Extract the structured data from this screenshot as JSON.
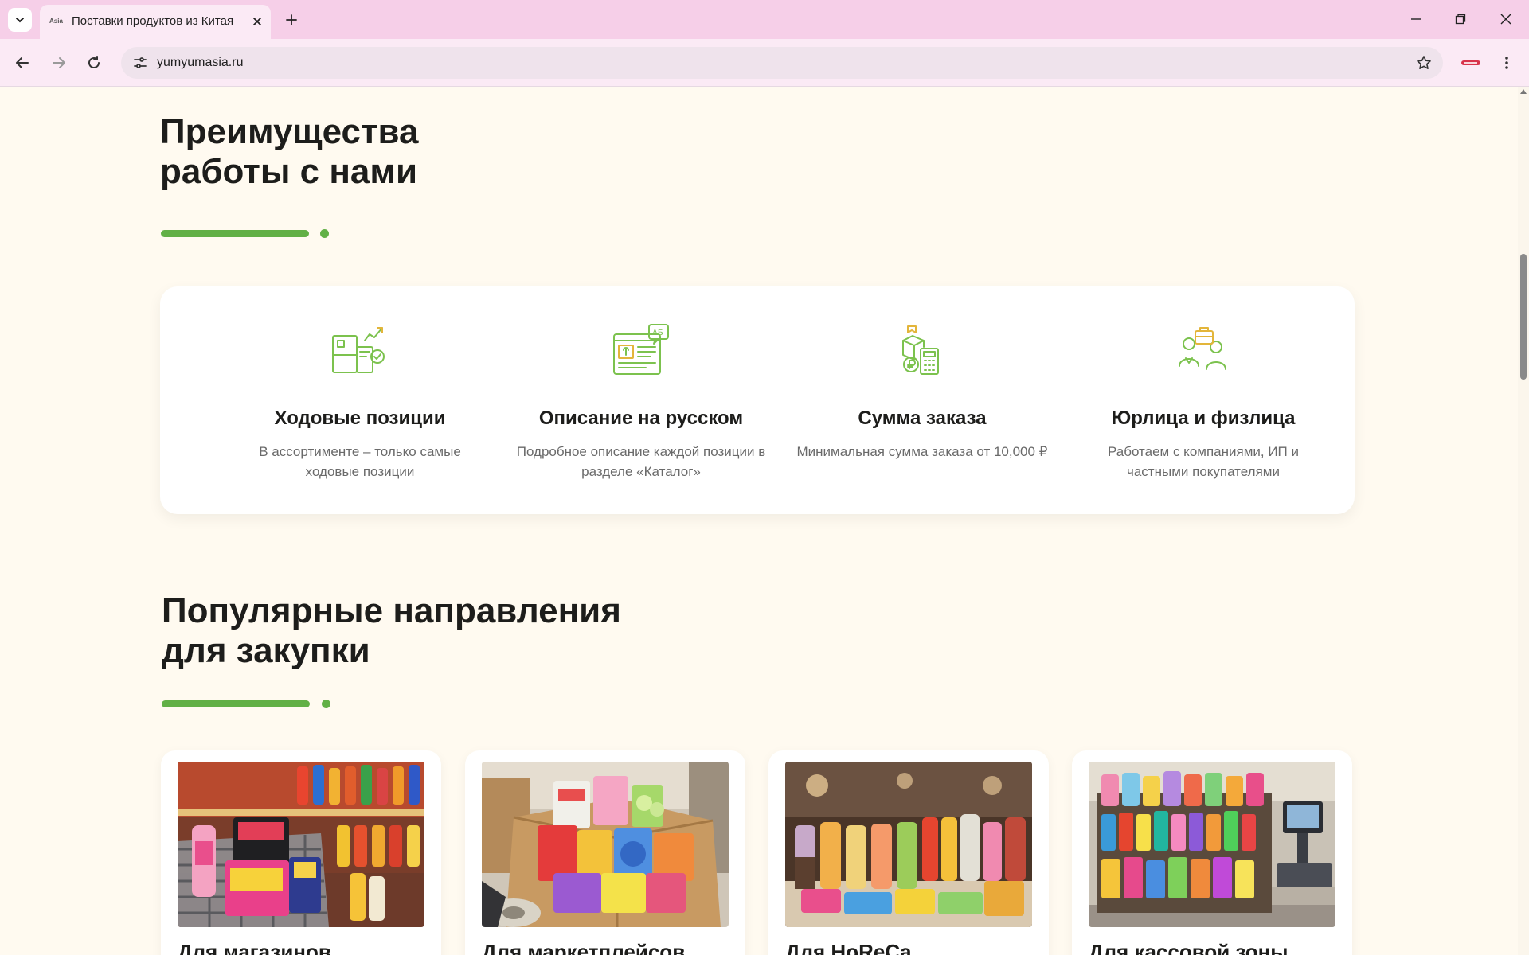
{
  "browser": {
    "tab_title": "Поставки продуктов из Китая",
    "tab_favicon": "Asia",
    "url": "yumyumasia.ru"
  },
  "advantages": {
    "title": "Преимущества\nработы с нами",
    "items": [
      {
        "icon": "products-chart-icon",
        "title": "Ходовые позиции",
        "desc": "В ассортименте – только самые ходовые позиции"
      },
      {
        "icon": "russian-description-icon",
        "title": "Описание на русском",
        "desc": "Подробное описание каждой позиции в разделе «Каталог»"
      },
      {
        "icon": "order-calculator-icon",
        "title": "Сумма заказа",
        "desc": "Минимальная сумма заказа от 10,000 ₽"
      },
      {
        "icon": "clients-icon",
        "title": "Юрлица и физлица",
        "desc": "Работаем с компаниями, ИП и частными покупателями"
      }
    ]
  },
  "popular": {
    "title": "Популярные направления\nдля закупки",
    "categories": [
      {
        "label": "Для магазинов"
      },
      {
        "label": "Для маркетплейсов"
      },
      {
        "label": "Для HoReCa"
      },
      {
        "label": "Для кассовой зоны"
      }
    ]
  },
  "colors": {
    "accent": "#62b046",
    "page_bg": "#fffaf0",
    "tabbar_bg": "#f6cfe8"
  }
}
